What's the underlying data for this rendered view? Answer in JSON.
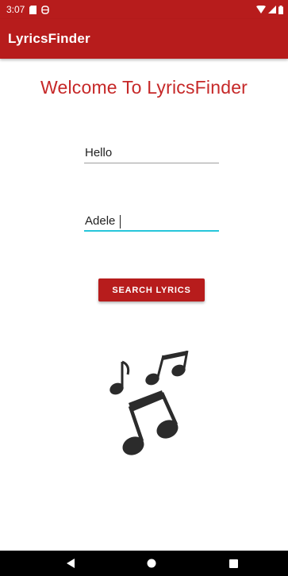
{
  "status_bar": {
    "time": "3:07",
    "icons": [
      "sd-card-icon",
      "sync-icon",
      "wifi-icon",
      "signal-icon",
      "battery-icon"
    ]
  },
  "app_bar": {
    "title": "LyricsFinder"
  },
  "main": {
    "welcome_text": "Welcome To LyricsFinder",
    "song_input": {
      "value": "Hello",
      "placeholder": ""
    },
    "artist_input": {
      "value": "Adele",
      "placeholder": ""
    },
    "search_button_label": "SEARCH LYRICS",
    "illustration": "music-notes-icon"
  },
  "nav_bar": {
    "buttons": [
      "back-icon",
      "home-icon",
      "recents-icon"
    ]
  },
  "colors": {
    "primary": "#b71c1c",
    "accent": "#26c6da",
    "heading": "#c62828",
    "notes": "#2b2b2b"
  }
}
